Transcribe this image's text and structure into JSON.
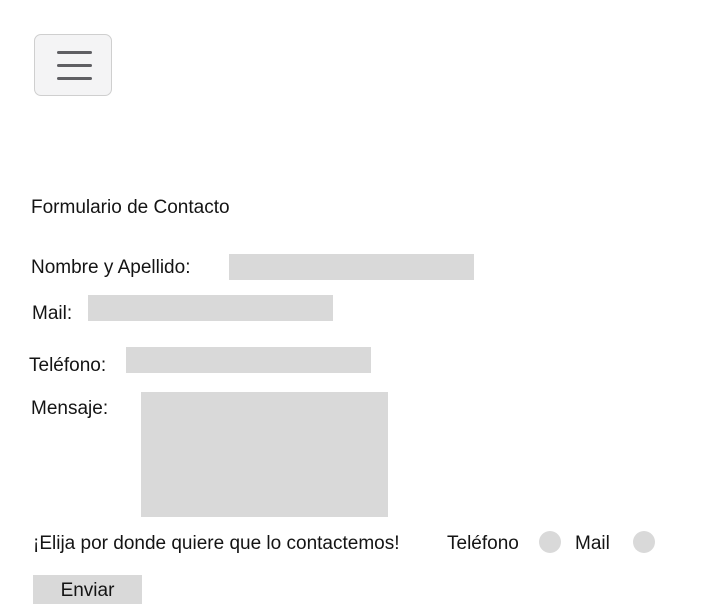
{
  "header": {
    "menu_icon": "hamburger-menu-icon"
  },
  "form": {
    "title": "Formulario de Contacto",
    "fields": {
      "name": {
        "label": "Nombre y Apellido:",
        "value": ""
      },
      "mail": {
        "label": "Mail:",
        "value": ""
      },
      "phone": {
        "label": "Teléfono:",
        "value": ""
      },
      "message": {
        "label": "Mensaje:",
        "value": ""
      }
    },
    "contact_preference": {
      "prompt": "¡Elija por donde quiere que lo contactemos!",
      "options": [
        "Teléfono",
        "Mail"
      ],
      "selected": ""
    },
    "submit_label": "Enviar"
  },
  "colors": {
    "field_background": "#d9d9d9",
    "menu_button_background": "#f4f4f5",
    "menu_button_border": "#cfcfcf",
    "menu_bars": "#5f5f63",
    "text": "#141414"
  }
}
